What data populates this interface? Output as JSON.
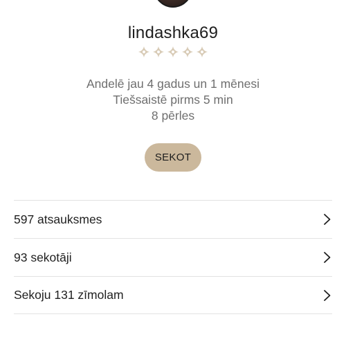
{
  "profile": {
    "username": "lindashka69",
    "rating_stars": 5,
    "rating_filled": 0,
    "member_since": "Andelē jau 4 gadus un 1 mēnesi",
    "last_seen": "Tiešsaistē pirms 5 min",
    "pearls": "8 pērles"
  },
  "actions": {
    "follow_label": "SEKOT"
  },
  "list": [
    {
      "label": "597 atsauksmes"
    },
    {
      "label": "93 sekotāji"
    },
    {
      "label": "Sekoju 131 zīmolam"
    }
  ],
  "colors": {
    "accent": "#cbb89c",
    "star": "#d8cbb6",
    "divider": "#e2e2e2",
    "muted_text": "#6f6f6f"
  }
}
